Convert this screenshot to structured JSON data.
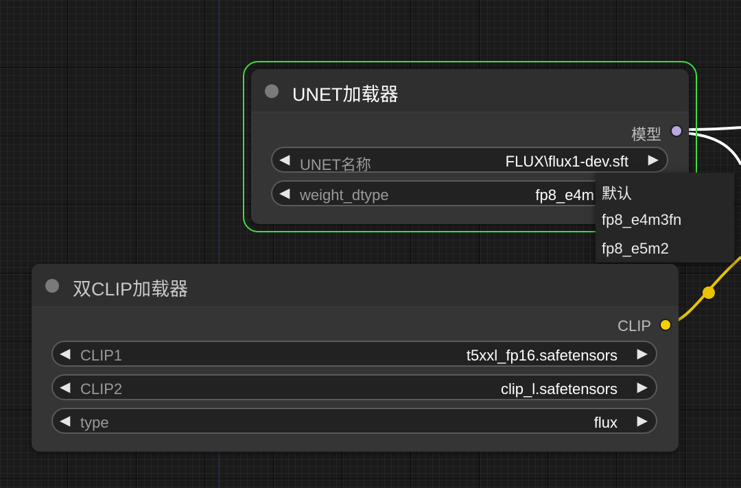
{
  "unet_node": {
    "title": "UNET加载器",
    "output_label": "模型",
    "output_color": "#b9a6e0",
    "widgets": [
      {
        "label": "UNET名称",
        "value": "FLUX\\flux1-dev.sft"
      },
      {
        "label": "weight_dtype",
        "value": "fp8_e4m"
      }
    ]
  },
  "dropdown": {
    "options": [
      "默认",
      "fp8_e4m3fn",
      "fp8_e5m2"
    ]
  },
  "clip_node": {
    "title": "双CLIP加载器",
    "output_label": "CLIP",
    "output_color": "#f5d000",
    "widgets": [
      {
        "label": "CLIP1",
        "value": "t5xxl_fp16.safetensors"
      },
      {
        "label": "CLIP2",
        "value": "clip_l.safetensors"
      },
      {
        "label": "type",
        "value": "flux"
      }
    ]
  },
  "colors": {
    "selection": "#3ee03e",
    "model_link": "#ffffff",
    "clip_link": "#e8c300"
  },
  "icons": {
    "arrow_left": "◀",
    "arrow_right": "▶"
  }
}
